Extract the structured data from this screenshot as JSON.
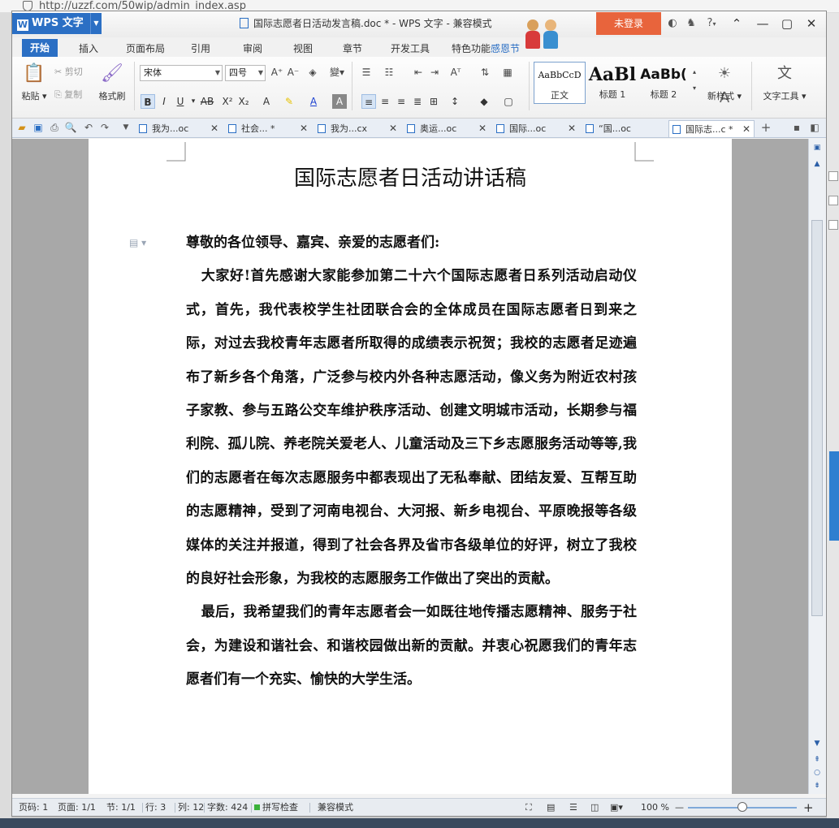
{
  "browser": {
    "url": "http://uzzf.com/50wip/admin_index.asp"
  },
  "titlebar": {
    "app_name": "WPS 文字",
    "app_logo": "W",
    "doc_title": "国际志愿者日活动发言稿.doc * - WPS 文字 - 兼容模式",
    "login_label": "未登录",
    "help_label": "?"
  },
  "ribbon_tabs": [
    "开始",
    "插入",
    "页面布局",
    "引用",
    "审阅",
    "视图",
    "章节",
    "开发工具",
    "特色功能",
    "感恩节"
  ],
  "ribbon": {
    "paste": "粘贴",
    "cut": "剪切",
    "copy": "复制",
    "format_painter": "格式刷",
    "font_name": "宋体",
    "font_size": "四号",
    "styles": [
      {
        "sample": "AaBbCcD",
        "name": "正文"
      },
      {
        "sample": "AaBl",
        "name": "标题 1"
      },
      {
        "sample": "AaBb(",
        "name": "标题 2"
      }
    ],
    "new_style": "新样式",
    "text_tools": "文字工具"
  },
  "doc_tabs": [
    {
      "label": "我为...oc",
      "active": false
    },
    {
      "label": "社会... *",
      "active": false
    },
    {
      "label": "我为...cx",
      "active": false
    },
    {
      "label": "奥运...oc",
      "active": false
    },
    {
      "label": "国际...oc",
      "active": false
    },
    {
      "label": "“国...oc",
      "active": false
    },
    {
      "label": "国际志...c *",
      "active": true
    }
  ],
  "document": {
    "heading": "国际志愿者日活动讲话稿",
    "salutation": "尊敬的各位领导、嘉宾、亲爱的志愿者们:",
    "paragraph1": "大家好!首先感谢大家能参加第二十六个国际志愿者日系列活动启动仪式，首先，我代表校学生社团联合会的全体成员在国际志愿者日到来之际，对过去我校青年志愿者所取得的成绩表示祝贺；我校的志愿者足迹遍布了新乡各个角落，广泛参与校内外各种志愿活动，像义务为附近农村孩子家教、参与五路公交车维护秩序活动、创建文明城市活动，长期参与福利院、孤儿院、养老院关爱老人、儿童活动及三下乡志愿服务活动等等,我们的志愿者在每次志愿服务中都表现出了无私奉献、团结友爱、互帮互助的志愿精神，受到了河南电视台、大河报、新乡电视台、平原晚报等各级媒体的关注并报道，得到了社会各界及省市各级单位的好评，树立了我校的良好社会形象，为我校的志愿服务工作做出了突出的贡献。",
    "paragraph2": "最后，我希望我们的青年志愿者会一如既往地传播志愿精神、服务于社会，为建设和谐社会、和谐校园做出新的贡献。并衷心祝愿我们的青年志愿者们有一个充实、愉快的大学生活。"
  },
  "statusbar": {
    "page_num": "页码: 1",
    "pages": "页面: 1/1",
    "section": "节: 1/1",
    "row": "行: 3",
    "col": "列: 12",
    "word_count": "字数: 424",
    "spell_check": "拼写检查",
    "compat_mode": "兼容模式",
    "zoom": "100 %",
    "zoom_fraction": 0.5
  },
  "colors": {
    "accent": "#2b6fc4",
    "login": "#e8643c"
  }
}
